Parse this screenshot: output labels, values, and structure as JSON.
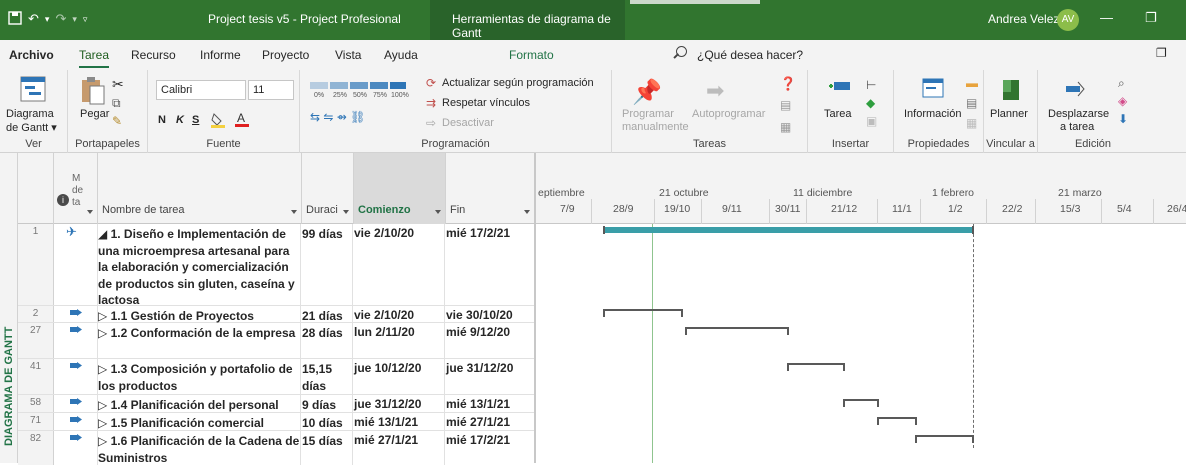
{
  "titlebar": {
    "doc_title": "Project tesis v5  -  Project Profesional",
    "context_title": "Herramientas de diagrama de Gantt",
    "user_name": "Andrea Velez",
    "user_initials": "AV",
    "minimize": "—",
    "restore": "❐"
  },
  "tabs": {
    "archivo": "Archivo",
    "tarea": "Tarea",
    "recurso": "Recurso",
    "informe": "Informe",
    "proyecto": "Proyecto",
    "vista": "Vista",
    "ayuda": "Ayuda",
    "formato": "Formato",
    "search_placeholder": "¿Qué desea hacer?",
    "restore_ribbon": "❐"
  },
  "ribbon": {
    "ver": {
      "btn1": "Diagrama",
      "btn2": "de Gantt ▾",
      "label": "Ver"
    },
    "portapapeles": {
      "pegar": "Pegar",
      "label": "Portapapeles"
    },
    "fuente": {
      "font": "Calibri",
      "size": "11",
      "bold": "N",
      "italic": "K",
      "underline": "S",
      "label": "Fuente"
    },
    "programacion": {
      "pct": [
        "0%",
        "25%",
        "50%",
        "75%",
        "100%"
      ],
      "actualizar": "Actualizar según programación",
      "respetar": "Respetar vínculos",
      "desactivar": "Desactivar",
      "label": "Programación"
    },
    "tareas": {
      "programar1": "Programar",
      "programar2": "manualmente",
      "auto": "Autoprogramar",
      "label": "Tareas"
    },
    "insertar": {
      "tarea": "Tarea",
      "label": "Insertar"
    },
    "propiedades": {
      "informacion": "Información",
      "label": "Propiedades"
    },
    "vincular": {
      "planner": "Planner",
      "label": "Vincular a"
    },
    "edicion": {
      "desplazarse1": "Desplazarse",
      "desplazarse2": "a tarea",
      "label": "Edición"
    }
  },
  "side_label": "DIAGRAMA DE GANTT",
  "grid": {
    "headers": {
      "mode_line1": "M",
      "mode_line2": "dе",
      "mode_line3": "ta",
      "name": "Nombre de tarea",
      "duration": "Duraci",
      "start": "Comienzo",
      "end": "Fin"
    },
    "rows": [
      {
        "id": "1",
        "name": "◢ 1. Diseño e Implementación de una microempresa artesanal para la elaboración y comercialización de productos sin gluten, caseína y lactosa",
        "duration": "99 días",
        "start": "vie 2/10/20",
        "end": "mié 17/2/21"
      },
      {
        "id": "2",
        "name": "▷ 1.1 Gestión de Proyectos",
        "duration": "21 días",
        "start": "vie 2/10/20",
        "end": "vie 30/10/20"
      },
      {
        "id": "27",
        "name": "▷ 1.2 Conformación de la empresa",
        "duration": "28 días",
        "start": "lun 2/11/20",
        "end": "mié 9/12/20"
      },
      {
        "id": "41",
        "name": "▷ 1.3 Composición y portafolio de los productos",
        "duration": "15,15 días",
        "start": "jue 10/12/20",
        "end": "jue 31/12/20"
      },
      {
        "id": "58",
        "name": "▷ 1.4 Planificación del personal",
        "duration": "9 días",
        "start": "jue 31/12/20",
        "end": "mié 13/1/21"
      },
      {
        "id": "71",
        "name": "▷ 1.5 Planificación comercial",
        "duration": "10 días",
        "start": "mié 13/1/21",
        "end": "mié 27/1/21"
      },
      {
        "id": "82",
        "name": "▷ 1.6 Planificación de la Cadena de Suministros",
        "duration": "15 días",
        "start": "mié 27/1/21",
        "end": "mié 17/2/21"
      }
    ]
  },
  "gantt": {
    "top_labels": [
      "eptiembre",
      "21 octubre",
      "11 diciembre",
      "1 febrero",
      "21 marzo"
    ],
    "bottom_labels": [
      "7/9",
      "28/9",
      "19/10",
      "9/11",
      "30/11",
      "21/12",
      "11/1",
      "1/2",
      "22/2",
      "15/3",
      "5/4",
      "26/4"
    ],
    "colors": {
      "summary": "#3a9ea8",
      "bar": "#595959",
      "today": "#8fc48f"
    }
  }
}
